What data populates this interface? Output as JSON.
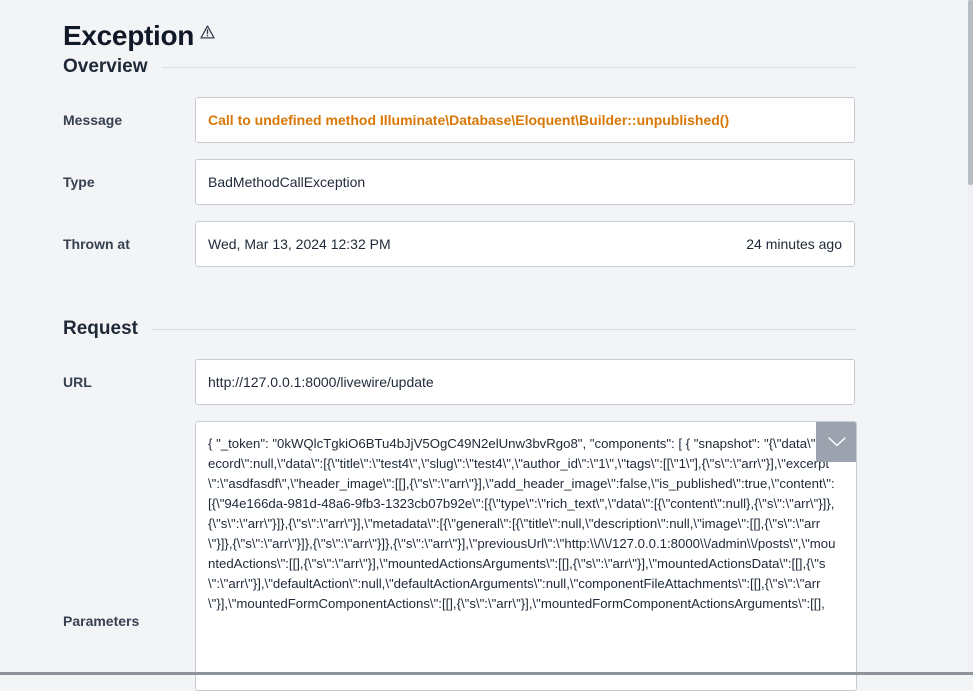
{
  "header": {
    "title": "Exception",
    "title_icon": "warning-triangle-icon"
  },
  "overview": {
    "heading": "Overview",
    "message": {
      "label": "Message",
      "value": "Call to undefined method Illuminate\\Database\\Eloquent\\Builder::unpublished()"
    },
    "type": {
      "label": "Type",
      "value": "BadMethodCallException"
    },
    "thrown_at": {
      "label": "Thrown at",
      "value": "Wed, Mar 13, 2024 12:32 PM",
      "relative": "24 minutes ago"
    }
  },
  "request": {
    "heading": "Request",
    "url": {
      "label": "URL",
      "value": "http://127.0.0.1:8000/livewire/update"
    },
    "parameters": {
      "label": "Parameters",
      "value": "{ \"_token\": \"0kWQlcTgkiO6BTu4bJjV5OgC49N2elUnw3bvRgo8\", \"components\": [ { \"snapshot\": \"{\\\"data\\\":{\\\"record\\\":null,\\\"data\\\":[{\\\"title\\\":\\\"test4\\\",\\\"slug\\\":\\\"test4\\\",\\\"author_id\\\":\\\"1\\\",\\\"tags\\\":[[\\\"1\\\"],{\\\"s\\\":\\\"arr\\\"}],\\\"excerpt\\\":\\\"asdfasdf\\\",\\\"header_image\\\":[[],{\\\"s\\\":\\\"arr\\\"}],\\\"add_header_image\\\":false,\\\"is_published\\\":true,\\\"content\\\":[{\\\"94e166da-981d-48a6-9fb3-1323cb07b92e\\\":[{\\\"type\\\":\\\"rich_text\\\",\\\"data\\\":[{\\\"content\\\":null},{\\\"s\\\":\\\"arr\\\"}]},{\\\"s\\\":\\\"arr\\\"}]},{\\\"s\\\":\\\"arr\\\"}],\\\"metadata\\\":[{\\\"general\\\":[{\\\"title\\\":null,\\\"description\\\":null,\\\"image\\\":[[],{\\\"s\\\":\\\"arr\\\"}]},{\\\"s\\\":\\\"arr\\\"}]},{\\\"s\\\":\\\"arr\\\"}]},{\\\"s\\\":\\\"arr\\\"}],\\\"previousUrl\\\":\\\"http:\\\\/\\\\/127.0.0.1:8000\\\\/admin\\\\/posts\\\",\\\"mountedActions\\\":[[],{\\\"s\\\":\\\"arr\\\"}],\\\"mountedActionsArguments\\\":[[],{\\\"s\\\":\\\"arr\\\"}],\\\"mountedActionsData\\\":[[],{\\\"s\\\":\\\"arr\\\"}],\\\"defaultAction\\\":null,\\\"defaultActionArguments\\\":null,\\\"componentFileAttachments\\\":[[],{\\\"s\\\":\\\"arr\\\"}],\\\"mountedFormComponentActions\\\":[[],{\\\"s\\\":\\\"arr\\\"}],\\\"mountedFormComponentActionsArguments\\\":[[],"
    }
  },
  "colors": {
    "message_text": "#d97706",
    "expand_button": "#9ca3af",
    "background": "#f3f4f6"
  }
}
